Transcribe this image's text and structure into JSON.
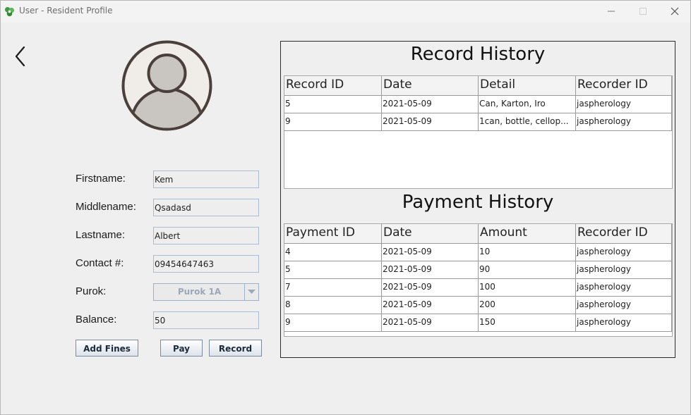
{
  "window": {
    "title": "User - Resident Profile"
  },
  "form": {
    "firstname_label": "Firstname:",
    "firstname": "Kem",
    "middlename_label": "Middlename:",
    "middlename": "Qsadasd",
    "lastname_label": "Lastname:",
    "lastname": "Albert",
    "contact_label": "Contact #:",
    "contact": "09454647463",
    "purok_label": "Purok:",
    "purok": "Purok 1A",
    "balance_label": "Balance:",
    "balance": "50"
  },
  "buttons": {
    "add_fines": "Add Fines",
    "pay": "Pay",
    "record": "Record"
  },
  "record_history": {
    "title": "Record History",
    "columns": [
      "Record ID",
      "Date",
      "Detail",
      "Recorder ID"
    ],
    "rows": [
      [
        "5",
        "2021-05-09",
        "Can, Karton, Iro",
        "jaspherology"
      ],
      [
        "9",
        "2021-05-09",
        "1can, bottle, cellop...",
        "jaspherology"
      ]
    ]
  },
  "payment_history": {
    "title": "Payment History",
    "columns": [
      "Payment ID",
      "Date",
      "Amount",
      "Recorder ID"
    ],
    "rows": [
      [
        "4",
        "2021-05-09",
        "10",
        "jaspherology"
      ],
      [
        "5",
        "2021-05-09",
        "90",
        "jaspherology"
      ],
      [
        "7",
        "2021-05-09",
        "100",
        "jaspherology"
      ],
      [
        "8",
        "2021-05-09",
        "200",
        "jaspherology"
      ],
      [
        "9",
        "2021-05-09",
        "150",
        "jaspherology"
      ]
    ]
  },
  "icons": {
    "app": "recycle-icon",
    "back": "back-arrow-icon",
    "avatar": "user-avatar-icon",
    "dropdown": "chevron-down-icon"
  },
  "colors": {
    "field_border": "#a8bcd6",
    "combo_text": "#9aa8bc",
    "panel_border": "#2c2c2c"
  }
}
